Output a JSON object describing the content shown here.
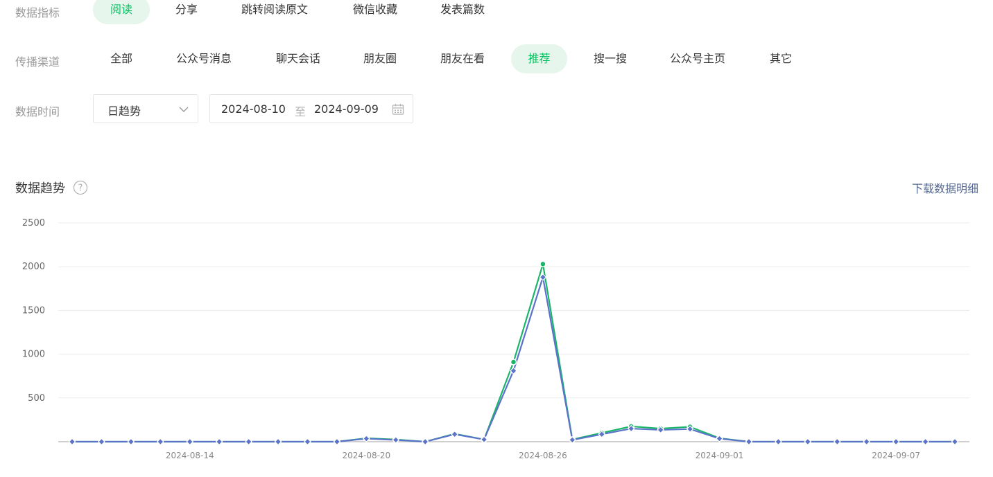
{
  "filters": {
    "metric": {
      "label": "数据指标",
      "options": [
        "阅读",
        "分享",
        "跳转阅读原文",
        "微信收藏",
        "发表篇数"
      ],
      "active_index": 0
    },
    "channel": {
      "label": "传播渠道",
      "options": [
        "全部",
        "公众号消息",
        "聊天会话",
        "朋友圈",
        "朋友在看",
        "推荐",
        "搜一搜",
        "公众号主页",
        "其它"
      ],
      "active_index": 5
    },
    "time": {
      "label": "数据时间",
      "granularity": "日趋势",
      "start_date": "2024-08-10",
      "separator": "至",
      "end_date": "2024-09-09"
    }
  },
  "section": {
    "title": "数据趋势",
    "download_label": "下载数据明细"
  },
  "icons": {
    "help": "help-circle-icon",
    "calendar": "calendar-icon",
    "chevron": "chevron-down-icon"
  },
  "colors": {
    "accent": "#07c160",
    "active_bg": "#e7f6ed",
    "link": "#576b95",
    "series_green": "#1bb56a",
    "series_blue": "#5b73c9"
  },
  "chart_data": {
    "type": "line",
    "x": [
      "2024-08-10",
      "2024-08-11",
      "2024-08-12",
      "2024-08-13",
      "2024-08-14",
      "2024-08-15",
      "2024-08-16",
      "2024-08-17",
      "2024-08-18",
      "2024-08-19",
      "2024-08-20",
      "2024-08-21",
      "2024-08-22",
      "2024-08-23",
      "2024-08-24",
      "2024-08-25",
      "2024-08-26",
      "2024-08-27",
      "2024-08-28",
      "2024-08-29",
      "2024-08-30",
      "2024-08-31",
      "2024-09-01",
      "2024-09-02",
      "2024-09-03",
      "2024-09-04",
      "2024-09-05",
      "2024-09-06",
      "2024-09-07",
      "2024-09-08",
      "2024-09-09"
    ],
    "x_tick_labels": [
      "2024-08-14",
      "2024-08-20",
      "2024-08-26",
      "2024-09-01",
      "2024-09-07"
    ],
    "y_ticks": [
      500,
      1000,
      1500,
      2000,
      2500
    ],
    "ylim": [
      0,
      2500
    ],
    "grid": true,
    "series": [
      {
        "color": "#1bb56a",
        "marker": "circle",
        "values": [
          0,
          0,
          0,
          0,
          0,
          0,
          0,
          0,
          0,
          0,
          40,
          25,
          0,
          90,
          25,
          910,
          2030,
          25,
          100,
          175,
          150,
          170,
          40,
          0,
          0,
          0,
          0,
          0,
          0,
          0,
          0
        ]
      },
      {
        "color": "#5b73c9",
        "marker": "diamond",
        "values": [
          0,
          0,
          0,
          0,
          0,
          0,
          0,
          0,
          0,
          0,
          35,
          20,
          0,
          85,
          25,
          810,
          1880,
          20,
          85,
          150,
          135,
          145,
          35,
          0,
          0,
          0,
          0,
          0,
          0,
          0,
          0
        ]
      }
    ]
  }
}
